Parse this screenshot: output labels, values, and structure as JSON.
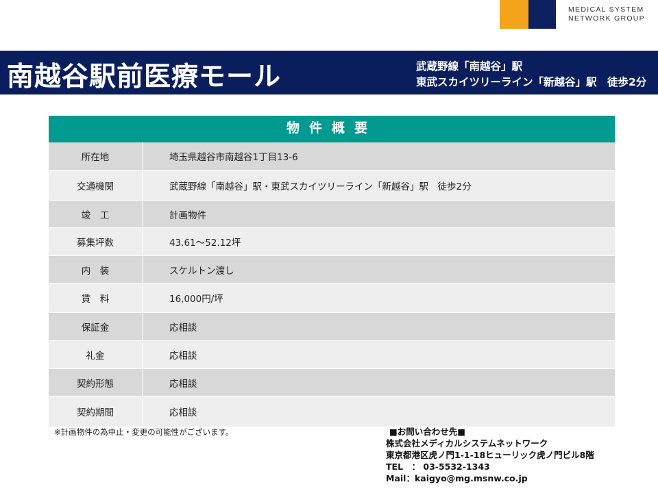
{
  "logo": {
    "line1": "MEDICAL SYSTEM",
    "line2": "NETWORK GROUP",
    "colors": {
      "orange": "#f5a31a",
      "navy": "#0e2060"
    }
  },
  "banner": {
    "title": "南越谷駅前医療モール",
    "access_line1": "武蔵野線「南越谷」駅",
    "access_line2": "東武スカイツリーライン「新越谷」駅　徒歩2分",
    "color": "#0a1e5e"
  },
  "table": {
    "header": "物件概要",
    "header_color": "#009a91",
    "rows": [
      {
        "label": "所在地",
        "value": "埼玉県越谷市南越谷1丁目13-6"
      },
      {
        "label": "交通機関",
        "value": "武蔵野線「南越谷」駅・東武スカイツリーライン「新越谷」駅　徒歩2分"
      },
      {
        "label": "竣　工",
        "value": "計画物件"
      },
      {
        "label": "募集坪数",
        "value": "43.61～52.12坪"
      },
      {
        "label": "内　装",
        "value": "スケルトン渡し"
      },
      {
        "label": "賃　料",
        "value": "16,000円/坪"
      },
      {
        "label": "保証金",
        "value": "応相談"
      },
      {
        "label": "礼金",
        "value": "応相談"
      },
      {
        "label": "契約形態",
        "value": "応相談"
      },
      {
        "label": "契約期間",
        "value": "応相談"
      }
    ]
  },
  "note": "※計画物件の為中止・変更の可能性がございます。",
  "contact": {
    "title": "■お問い合わせ先■",
    "company": "株式会社メディカルシステムネットワーク",
    "address": "東京都港区虎ノ門1-1-18ヒューリック虎ノ門ビル8階",
    "tel": "TEL　：  03-5532-1343",
    "mail": "Mail：kaigyo@mg.msnw.co.jp"
  }
}
